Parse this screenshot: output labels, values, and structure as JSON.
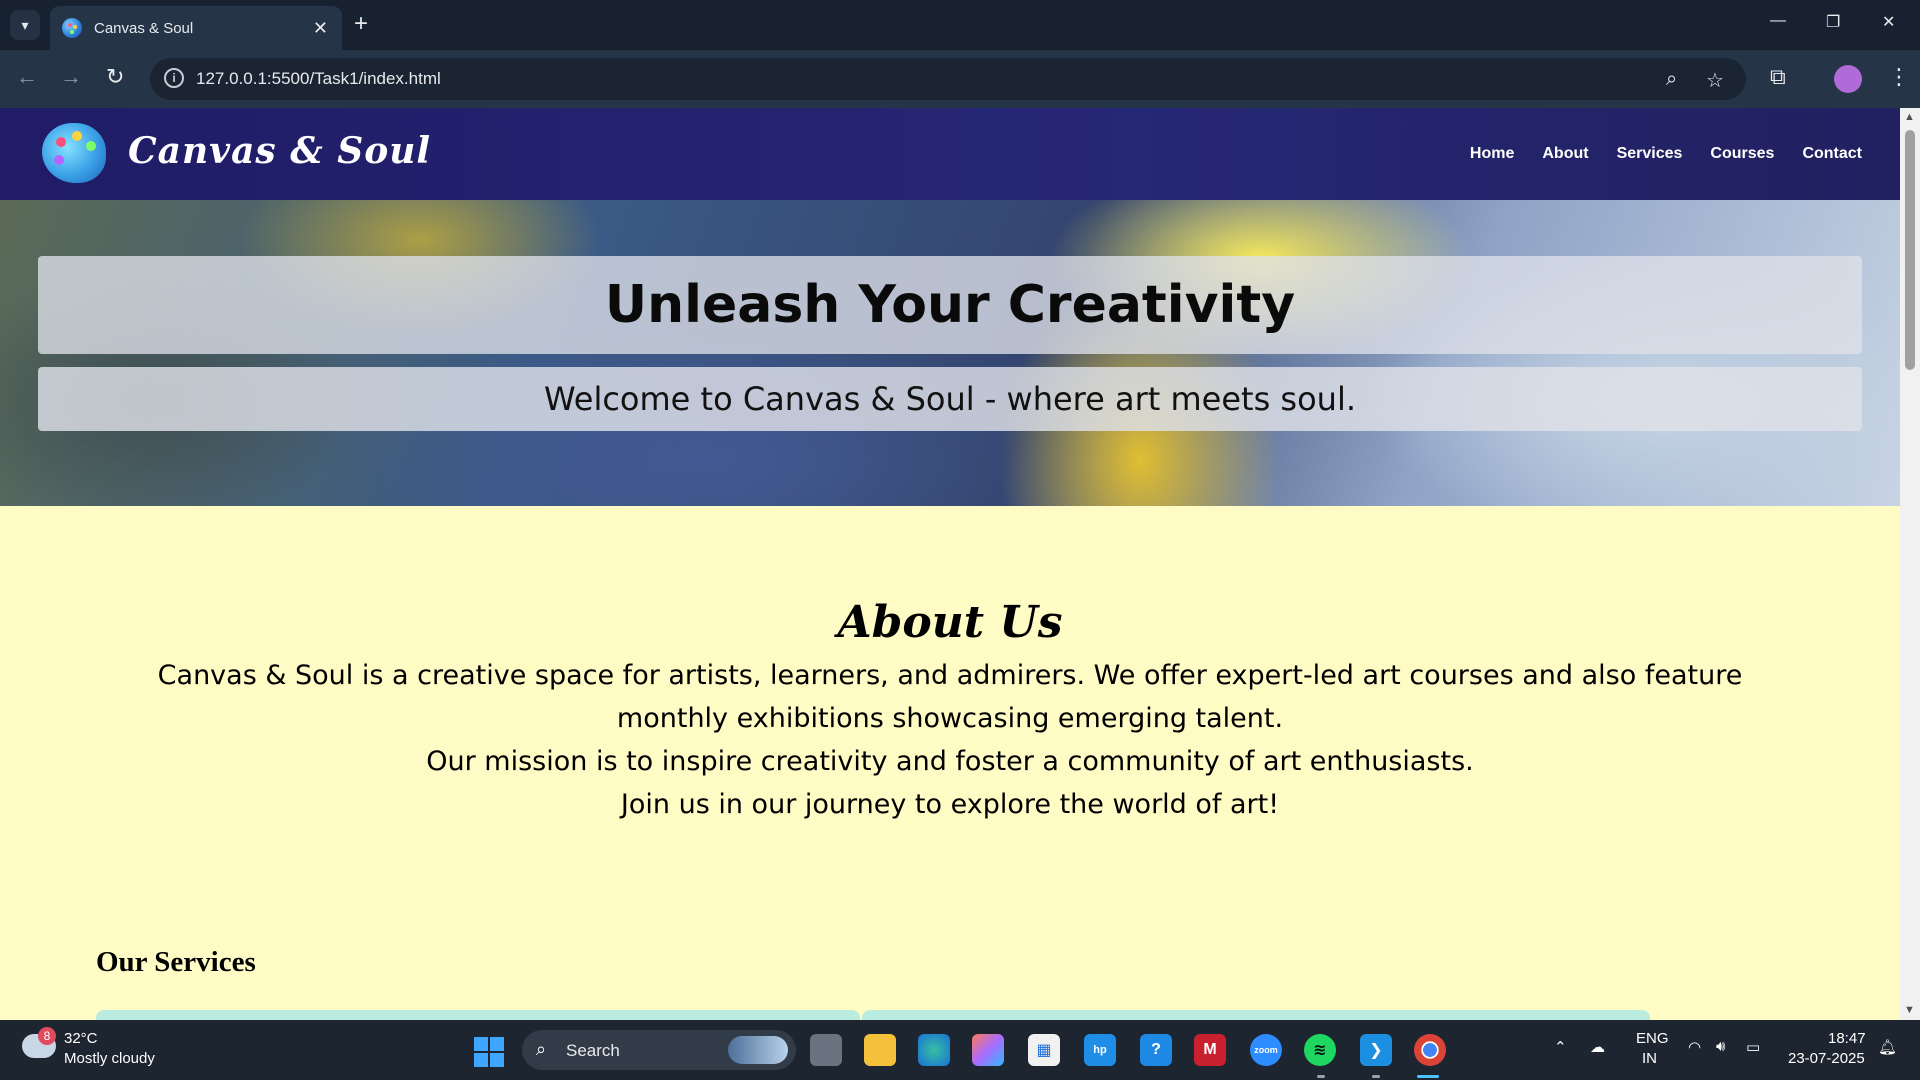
{
  "browser": {
    "tab_title": "Canvas & Soul",
    "url": "127.0.0.1:5500/Task1/index.html",
    "icons": {
      "tab_list": "chevron-down-icon",
      "close_tab": "close-icon",
      "new_tab": "plus-icon",
      "back": "back-arrow-icon",
      "forward": "forward-arrow-icon",
      "reload": "reload-icon",
      "site_info": "info-icon",
      "zoom": "zoom-icon",
      "bookmark": "star-icon",
      "extensions": "puzzle-icon",
      "menu": "kebab-menu-icon"
    }
  },
  "site": {
    "brand": "Canvas & Soul",
    "nav": [
      "Home",
      "About",
      "Services",
      "Courses",
      "Contact"
    ],
    "hero": {
      "title": "Unleash Your Creativity",
      "subtitle": "Welcome to Canvas & Soul - where art meets soul."
    },
    "about": {
      "heading": "About Us",
      "lines": [
        "Canvas & Soul is a creative space for artists, learners, and admirers. We offer expert-led art courses and also feature monthly exhibitions showcasing emerging talent.",
        "Our mission is to inspire creativity and foster a community of art enthusiasts.",
        "Join us in our journey to explore the world of art!"
      ]
    },
    "services_heading": "Our Services",
    "colors": {
      "header_bg": "#232270",
      "page_bg": "#fffbc4",
      "card_bg": "#b9ecdf"
    }
  },
  "taskbar": {
    "weather": {
      "badge": "8",
      "temp": "32°C",
      "desc": "Mostly cloudy"
    },
    "search_label": "Search",
    "apps": [
      "task-view",
      "file-explorer",
      "edge",
      "copilot",
      "microsoft-store",
      "myhp",
      "help",
      "mcafee",
      "zoom",
      "spotify",
      "vscode",
      "chrome"
    ],
    "tray": {
      "lang_top": "ENG",
      "lang_bottom": "IN",
      "time": "18:47",
      "date": "23-07-2025"
    }
  }
}
